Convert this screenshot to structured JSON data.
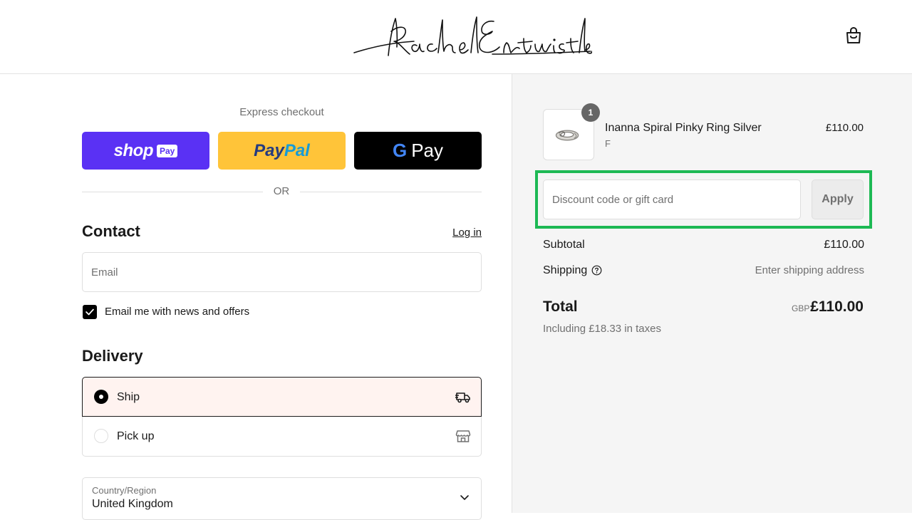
{
  "header": {
    "brand": "Rachel Entwistle",
    "cart_icon": "shopping-bag-icon"
  },
  "express": {
    "label": "Express checkout",
    "shop_pay": {
      "word": "shop",
      "badge": "Pay"
    },
    "paypal": {
      "part1": "Pay",
      "part2": "Pal"
    },
    "google_pay": {
      "g": "G",
      "word": "Pay"
    },
    "divider": "OR"
  },
  "contact": {
    "title": "Contact",
    "login_link": "Log in",
    "email_placeholder": "Email",
    "email_value": "",
    "newsletter_label": "Email me with news and offers",
    "newsletter_checked": true
  },
  "delivery": {
    "title": "Delivery",
    "options": [
      {
        "label": "Ship",
        "selected": true,
        "icon": "truck-icon"
      },
      {
        "label": "Pick up",
        "selected": false,
        "icon": "store-icon"
      }
    ],
    "country_label": "Country/Region",
    "country_value": "United Kingdom"
  },
  "summary": {
    "item": {
      "name": "Inanna Spiral Pinky Ring Silver",
      "variant": "F",
      "price": "£110.00",
      "quantity": "1"
    },
    "discount_placeholder": "Discount code or gift card",
    "apply_label": "Apply",
    "subtotal_label": "Subtotal",
    "subtotal_value": "£110.00",
    "shipping_label": "Shipping",
    "shipping_value": "Enter shipping address",
    "total_label": "Total",
    "currency": "GBP",
    "total_value": "£110.00",
    "tax_note": "Including £18.33 in taxes"
  },
  "colors": {
    "shop_pay": "#5a31f4",
    "paypal": "#ffc439",
    "google_pay": "#000000",
    "selected_option_bg": "#fff3f0",
    "highlight": "#1db954"
  }
}
